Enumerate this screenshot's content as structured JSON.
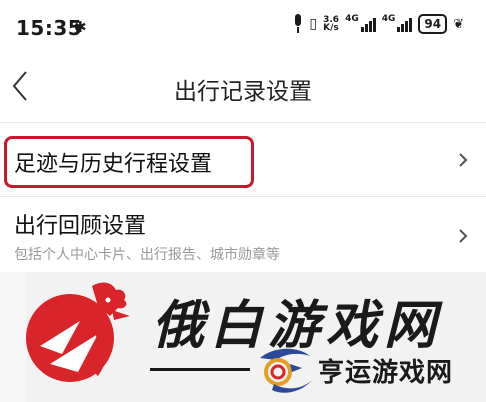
{
  "status_bar": {
    "time": "15:35",
    "bluetooth_icon": "bluetooth-icon",
    "net_speed_value": "3.6",
    "net_speed_unit": "K/s",
    "sim1_label": "4G",
    "sim2_label": "4G",
    "battery": "94"
  },
  "header": {
    "title": "出行记录设置",
    "back_icon": "back-arrow-icon"
  },
  "settings": {
    "items": [
      {
        "label": "足迹与历史行程设置",
        "subtitle": ""
      },
      {
        "label": "出行回顾设置",
        "subtitle": "包括个人中心卡片、出行报告、城市勋章等"
      }
    ]
  },
  "watermark": {
    "main_text": "俄白游戏网",
    "sub_text": "亨运游戏网"
  },
  "colors": {
    "highlight": "#c41a2b",
    "logo_red": "#d9252a",
    "subtitle_gray": "#999999"
  }
}
